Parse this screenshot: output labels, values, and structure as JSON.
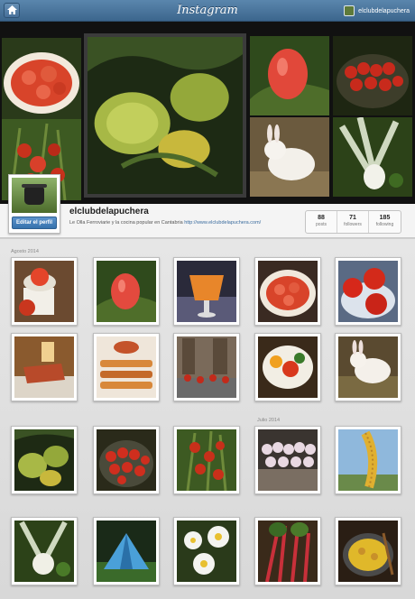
{
  "app": {
    "title": "Instagram"
  },
  "header": {
    "username": "elclubdelapuchera",
    "home_icon": "home-icon"
  },
  "profile": {
    "name": "elclubdelapuchera",
    "bio": "Le Olla Ferroviarie y la cocina popular en Cantabria",
    "link": "http://www.elclubdelapuchera.com/",
    "edit_label": "Editar el perfil",
    "stats": [
      {
        "value": "88",
        "label": "posts"
      },
      {
        "value": "71",
        "label": "followers"
      },
      {
        "value": "185",
        "label": "following"
      }
    ]
  },
  "feed": {
    "month_1": "Agosto 2014",
    "month_2": "Julio 2014",
    "photos": [
      "tomato-slices-plate",
      "green-tomatoes-plant",
      "red-tomato-on-leaves",
      "tomatoes-in-bowl",
      "white-rabbit",
      "leeks-in-garden",
      "tomato-kitchen-scale",
      "red-pepper-tomato",
      "orange-drink-glass",
      "sliced-tomatoes-plate",
      "red-tomatoes-bowl",
      "food-on-table",
      "pastries-tray",
      "outdoor-picnic",
      "tomato-salad-plate",
      "rabbit-on-grass",
      "green-tomatoes-plant-2",
      "cherry-tomatoes-bowl",
      "tomato-vines",
      "onions-on-table",
      "corn-cob-sky",
      "cabbage-in-garden",
      "tent-camping",
      "white-daisies",
      "red-chard-stems",
      "yellow-stew-pot"
    ]
  }
}
